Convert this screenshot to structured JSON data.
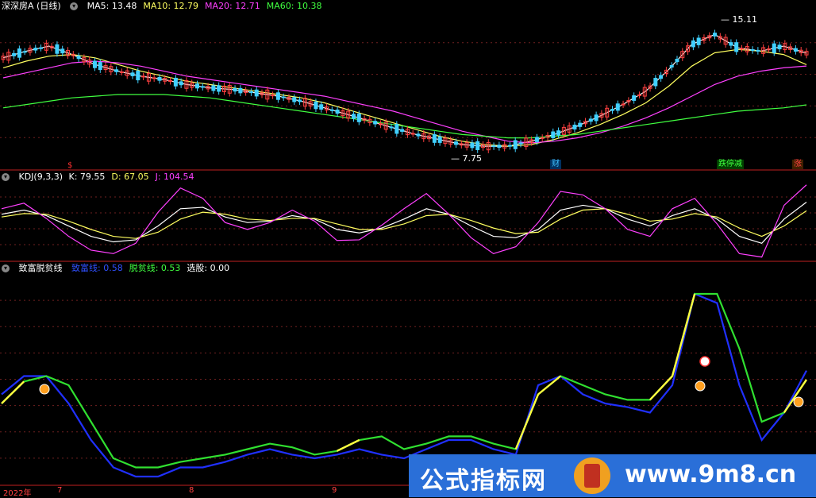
{
  "panel1": {
    "title": "深深房A (日线)",
    "indicators": [
      {
        "label": "MA5: 13.48",
        "color": "#ffffff"
      },
      {
        "label": "MA10: 12.79",
        "color": "#ffff60"
      },
      {
        "label": "MA20: 12.71",
        "color": "#ff40ff"
      },
      {
        "label": "MA60: 10.38",
        "color": "#40ff40"
      }
    ],
    "high_label": "15.11",
    "low_label": "7.75",
    "markers": [
      {
        "text": "$",
        "color": "#ff3030"
      },
      {
        "text": "财",
        "color": "#40c0ff"
      },
      {
        "text": "跌停减",
        "color": "#40ff40"
      },
      {
        "text": "涨",
        "color": "#ff4040"
      }
    ]
  },
  "panel2": {
    "title": "KDJ(9,3,3)",
    "indicators": [
      {
        "label": "K: 79.55",
        "color": "#ffffff"
      },
      {
        "label": "D: 67.05",
        "color": "#ffff60"
      },
      {
        "label": "J: 104.54",
        "color": "#ff40ff"
      }
    ]
  },
  "panel3": {
    "title": "致富脱贫线",
    "indicators": [
      {
        "label": "致富线: 0.58",
        "color": "#3050ff"
      },
      {
        "label": "脱贫线: 0.53",
        "color": "#40ff40"
      },
      {
        "label": "选股: 0.00",
        "color": "#ffffff"
      }
    ]
  },
  "x_axis": {
    "labels": [
      "2022年",
      "7",
      "8",
      "9"
    ]
  },
  "watermark": {
    "text1": "公式指标网",
    "text2": "www.9m8.cn"
  },
  "chart_data": [
    {
      "type": "candlestick",
      "title": "深深房A (日线)",
      "series": [
        {
          "name": "MA5",
          "values": [
            13.2,
            13.6,
            13.9,
            13.4,
            12.8,
            12.4,
            12.1,
            11.9,
            11.6,
            11.4,
            11.3,
            11.1,
            10.9,
            10.6,
            10.2,
            9.8,
            9.4,
            9.0,
            8.6,
            8.3,
            8.0,
            7.9,
            7.9,
            8.2,
            8.6,
            9.1,
            9.7,
            10.4,
            11.2,
            12.5,
            14.0,
            14.6,
            13.8,
            13.6,
            13.9,
            13.48
          ]
        },
        {
          "name": "MA10",
          "values": [
            12.6,
            13.0,
            13.3,
            13.4,
            13.2,
            12.8,
            12.4,
            12.1,
            11.8,
            11.6,
            11.4,
            11.2,
            11.0,
            10.8,
            10.5,
            10.1,
            9.7,
            9.3,
            8.9,
            8.5,
            8.2,
            8.0,
            7.9,
            8.0,
            8.3,
            8.7,
            9.2,
            9.8,
            10.5,
            11.5,
            12.7,
            13.5,
            13.7,
            13.6,
            13.4,
            12.79
          ]
        },
        {
          "name": "MA20",
          "values": [
            12.0,
            12.3,
            12.6,
            12.9,
            13.0,
            12.9,
            12.7,
            12.4,
            12.1,
            11.9,
            11.7,
            11.5,
            11.3,
            11.1,
            10.9,
            10.6,
            10.3,
            10.0,
            9.6,
            9.2,
            8.8,
            8.5,
            8.2,
            8.1,
            8.2,
            8.4,
            8.7,
            9.1,
            9.6,
            10.2,
            10.9,
            11.6,
            12.1,
            12.4,
            12.6,
            12.71
          ]
        },
        {
          "name": "MA60",
          "values": [
            10.2,
            10.4,
            10.6,
            10.8,
            10.9,
            11.0,
            11.0,
            11.0,
            10.9,
            10.8,
            10.6,
            10.4,
            10.2,
            10.0,
            9.8,
            9.6,
            9.4,
            9.2,
            9.0,
            8.8,
            8.6,
            8.5,
            8.4,
            8.4,
            8.5,
            8.6,
            8.8,
            9.0,
            9.2,
            9.4,
            9.6,
            9.8,
            10.0,
            10.1,
            10.2,
            10.38
          ]
        }
      ],
      "high": 15.11,
      "low": 7.75
    },
    {
      "type": "line",
      "title": "KDJ(9,3,3)",
      "series": [
        {
          "name": "K",
          "values": [
            62,
            68,
            60,
            45,
            30,
            22,
            25,
            45,
            70,
            72,
            58,
            50,
            52,
            60,
            55,
            40,
            35,
            42,
            55,
            70,
            62,
            45,
            30,
            28,
            40,
            68,
            75,
            70,
            55,
            45,
            60,
            70,
            55,
            30,
            20,
            55,
            79.55
          ]
        },
        {
          "name": "D",
          "values": [
            58,
            63,
            62,
            52,
            40,
            30,
            27,
            36,
            55,
            65,
            62,
            55,
            53,
            56,
            56,
            48,
            40,
            40,
            48,
            60,
            62,
            53,
            42,
            34,
            36,
            55,
            68,
            70,
            62,
            52,
            55,
            63,
            58,
            42,
            30,
            45,
            67.05
          ]
        },
        {
          "name": "J",
          "values": [
            70,
            78,
            56,
            30,
            10,
            5,
            20,
            65,
            100,
            85,
            50,
            40,
            50,
            68,
            52,
            24,
            25,
            46,
            70,
            92,
            62,
            28,
            5,
            15,
            50,
            95,
            90,
            70,
            40,
            30,
            70,
            85,
            48,
            5,
            0,
            75,
            104.54
          ]
        }
      ]
    },
    {
      "type": "line",
      "title": "致富脱贫线",
      "series": [
        {
          "name": "致富线",
          "values": [
            0.45,
            0.55,
            0.55,
            0.4,
            0.2,
            0.05,
            0.0,
            0.0,
            0.05,
            0.05,
            0.08,
            0.12,
            0.15,
            0.12,
            0.1,
            0.12,
            0.15,
            0.12,
            0.1,
            0.15,
            0.2,
            0.2,
            0.15,
            0.12,
            0.5,
            0.55,
            0.45,
            0.4,
            0.38,
            0.35,
            0.5,
            1.0,
            0.95,
            0.5,
            0.2,
            0.35,
            0.58
          ]
        },
        {
          "name": "脱贫线",
          "values": [
            0.4,
            0.52,
            0.55,
            0.5,
            0.3,
            0.1,
            0.05,
            0.05,
            0.08,
            0.1,
            0.12,
            0.15,
            0.18,
            0.16,
            0.12,
            0.14,
            0.2,
            0.22,
            0.15,
            0.18,
            0.22,
            0.22,
            0.18,
            0.15,
            0.45,
            0.55,
            0.5,
            0.45,
            0.42,
            0.42,
            0.55,
            1.0,
            1.0,
            0.7,
            0.3,
            0.35,
            0.53
          ]
        }
      ]
    }
  ]
}
